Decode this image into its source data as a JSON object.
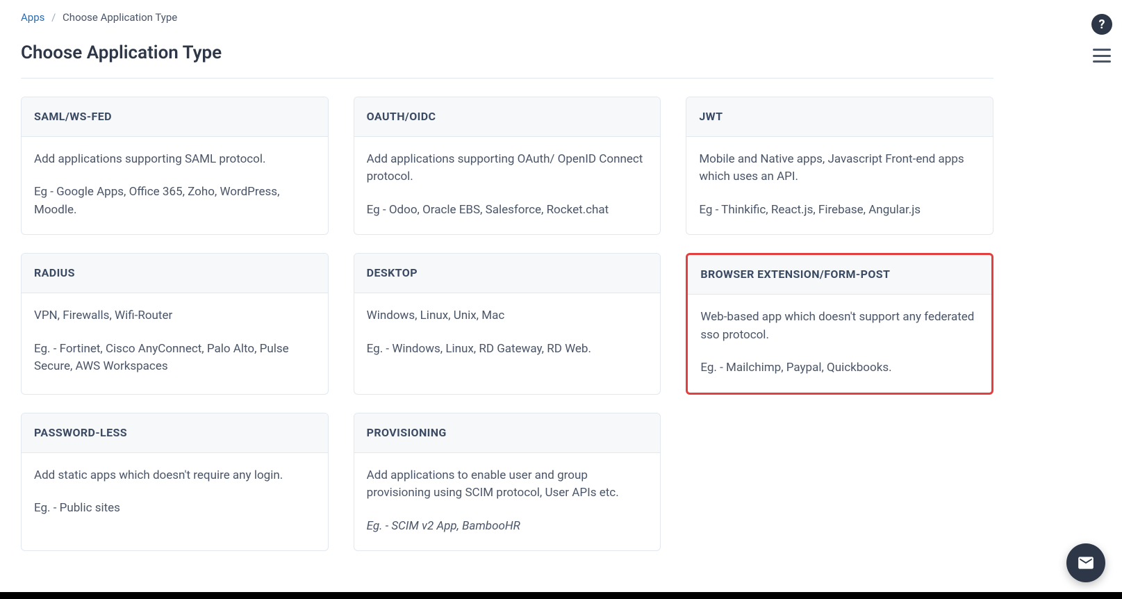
{
  "breadcrumb": {
    "root": "Apps",
    "current": "Choose Application Type"
  },
  "page_title": "Choose Application Type",
  "cards": [
    {
      "title": "SAML/WS-FED",
      "desc": "Add applications supporting SAML protocol.",
      "example": "Eg - Google Apps, Office 365, Zoho, WordPress, Moodle.",
      "highlight": false
    },
    {
      "title": "OAUTH/OIDC",
      "desc": "Add applications supporting OAuth/ OpenID Connect protocol.",
      "example": "Eg - Odoo, Oracle EBS, Salesforce, Rocket.chat",
      "highlight": false
    },
    {
      "title": "JWT",
      "desc": "Mobile and Native apps, Javascript Front-end apps which uses an API.",
      "example": "Eg - Thinkific, React.js, Firebase, Angular.js",
      "highlight": false
    },
    {
      "title": "RADIUS",
      "desc": "VPN, Firewalls, Wifi-Router",
      "example": "Eg. - Fortinet, Cisco AnyConnect, Palo Alto, Pulse Secure, AWS Workspaces",
      "highlight": false
    },
    {
      "title": "DESKTOP",
      "desc": "Windows, Linux, Unix, Mac",
      "example": "Eg. - Windows, Linux, RD Gateway, RD Web.",
      "highlight": false
    },
    {
      "title": "BROWSER EXTENSION/FORM-POST",
      "desc": "Web-based app which doesn't support any federated sso protocol.",
      "example": "Eg. - Mailchimp, Paypal, Quickbooks.",
      "highlight": true
    },
    {
      "title": "PASSWORD-LESS",
      "desc": "Add static apps which doesn't require any login.",
      "example": "Eg. - Public sites",
      "highlight": false
    },
    {
      "title": "PROVISIONING",
      "desc": "Add applications to enable user and group provisioning using SCIM protocol, User APIs etc.",
      "example": "Eg. - SCIM v2 App, BambooHR",
      "example_italic": true,
      "highlight": false
    }
  ]
}
